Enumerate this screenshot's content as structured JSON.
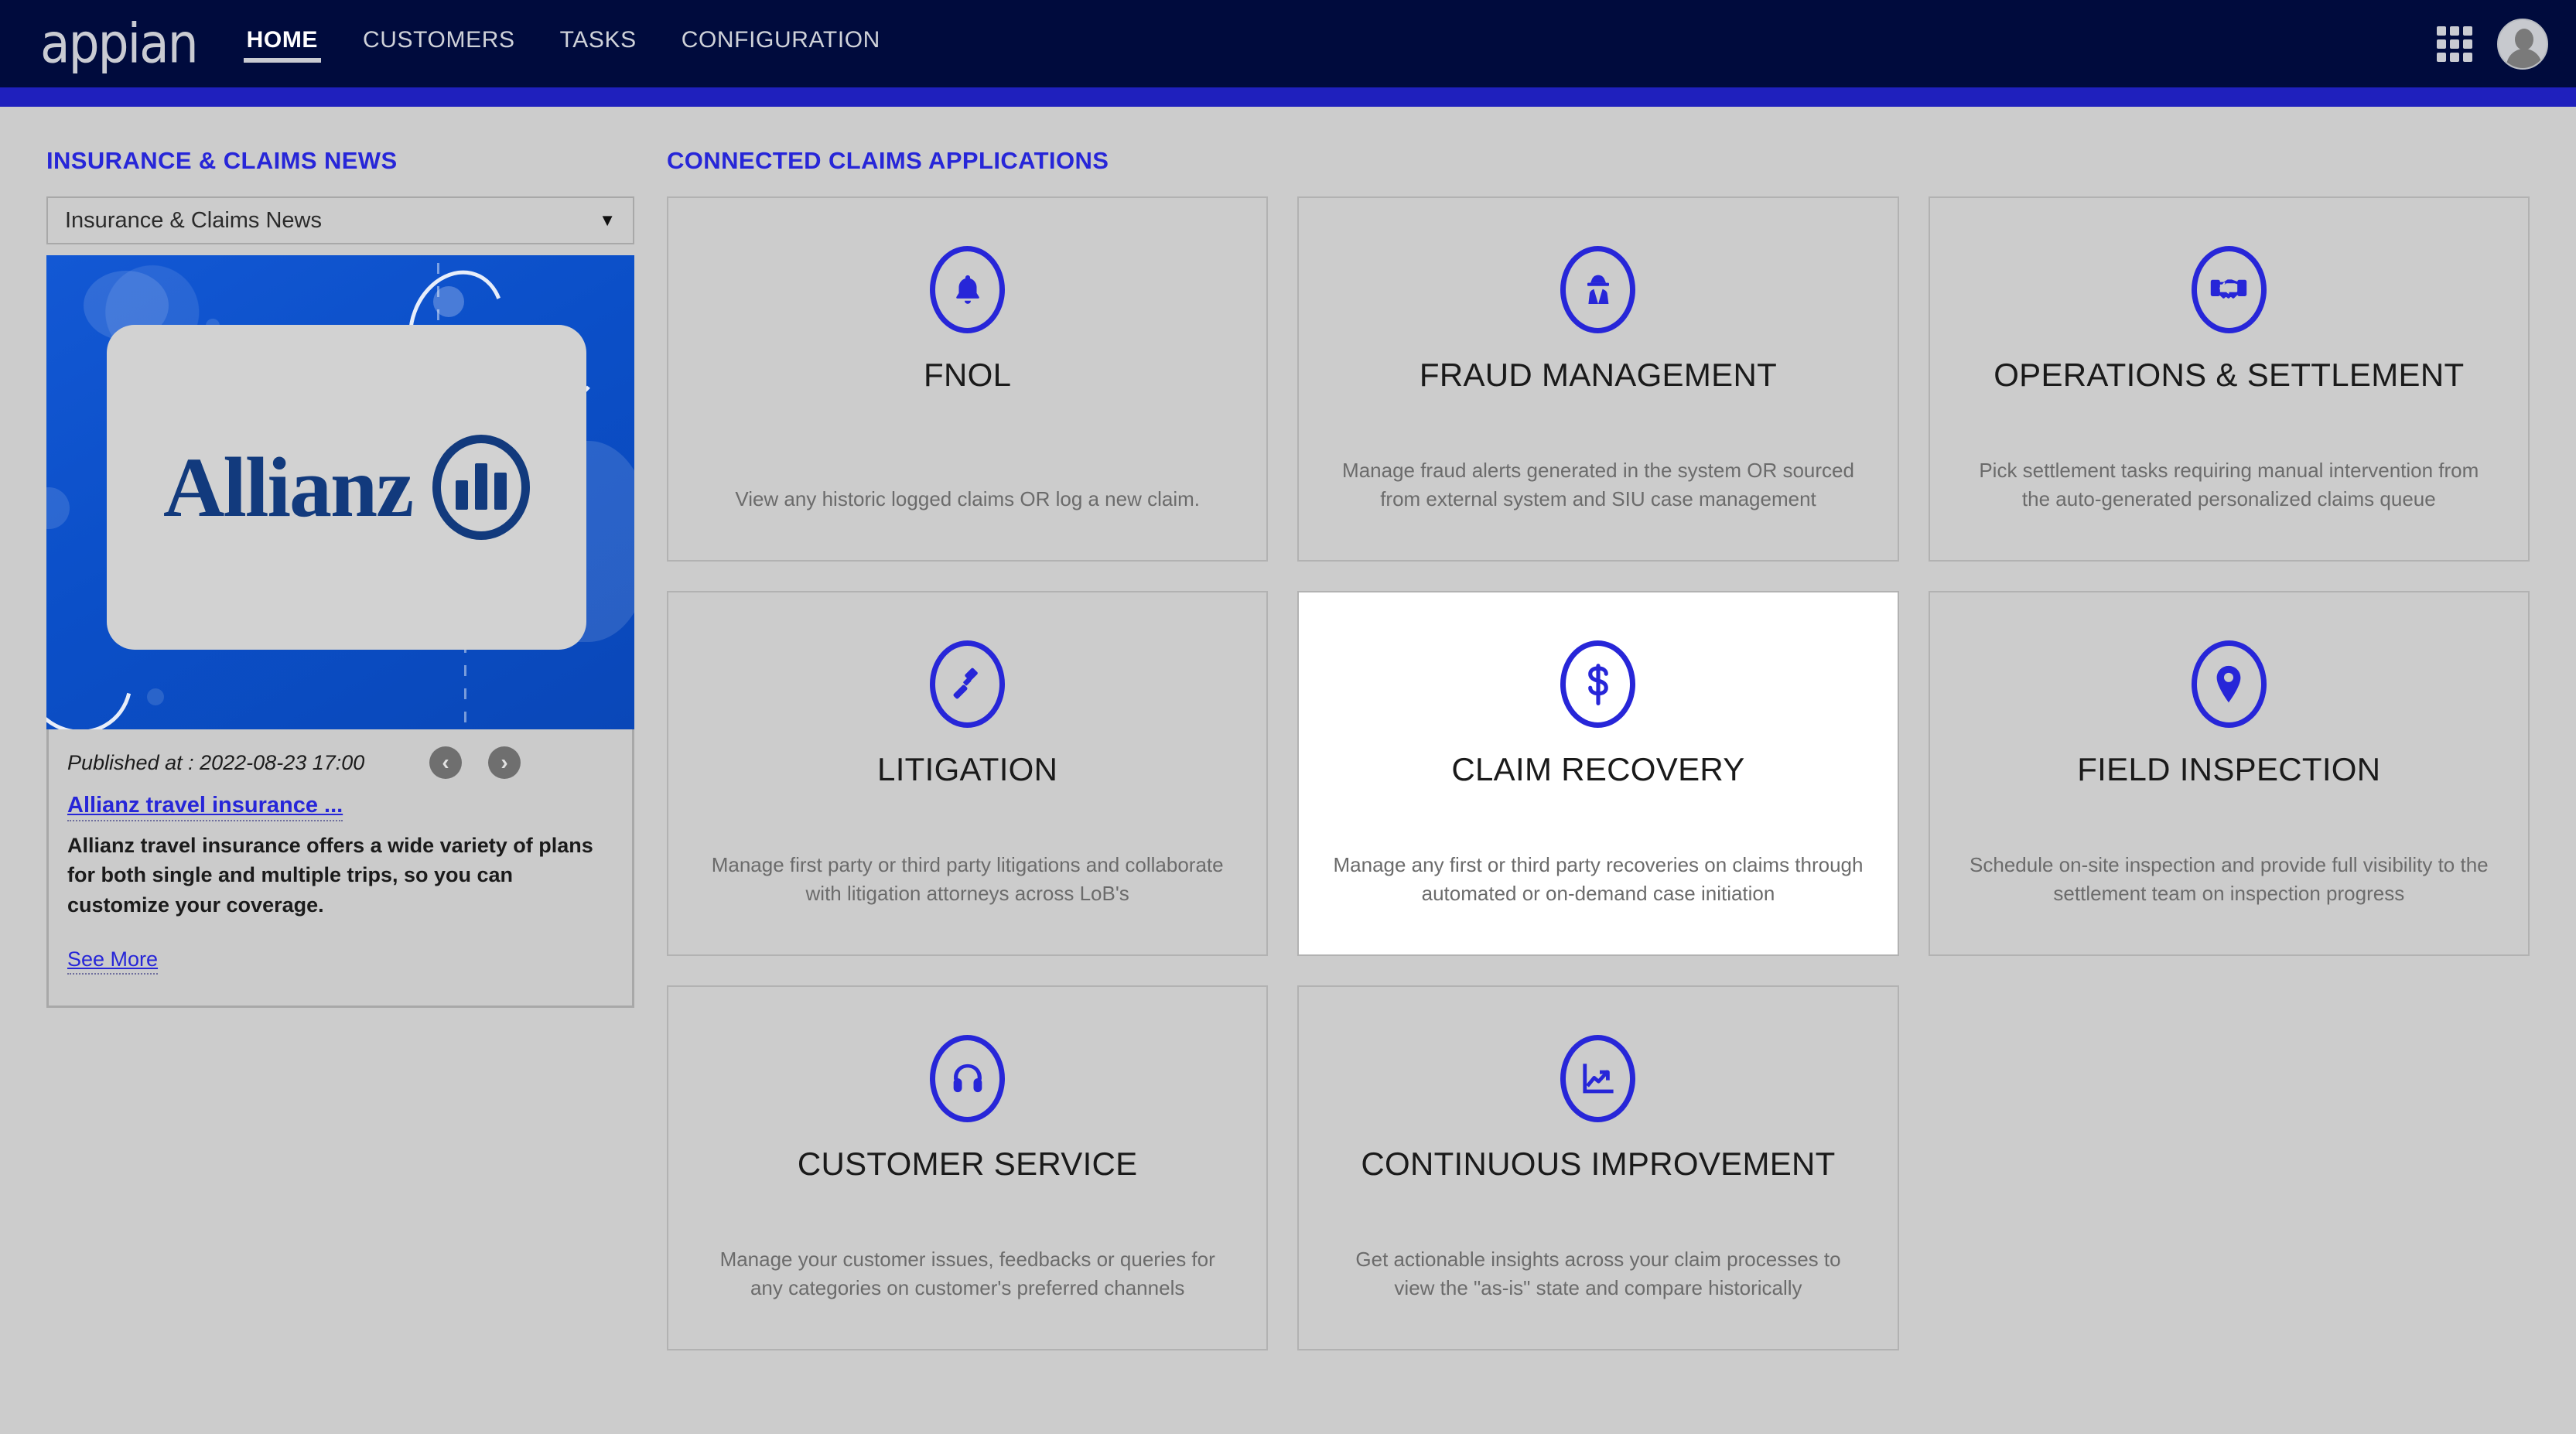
{
  "header": {
    "logo_text": "appian",
    "nav": [
      {
        "label": "HOME",
        "active": true
      },
      {
        "label": "CUSTOMERS",
        "active": false
      },
      {
        "label": "TASKS",
        "active": false
      },
      {
        "label": "CONFIGURATION",
        "active": false
      }
    ],
    "grid_icon": "apps-grid-icon",
    "avatar": "user-avatar",
    "navy": "#000b3d",
    "accent": "#1f20bd"
  },
  "news": {
    "section_title": "INSURANCE & CLAIMS NEWS",
    "select_value": "Insurance & Claims News",
    "select_caret": "▼",
    "image_alt": "Allianz",
    "brand_word": "Allianz",
    "published": "Published at : 2022-08-23 17:00",
    "prev_label": "‹",
    "next_label": "›",
    "headline": "Allianz travel insurance ...",
    "summary": "Allianz travel insurance offers a wide variety of plans for both single and multiple trips, so you can customize your coverage.",
    "see_more": "See More"
  },
  "apps": {
    "section_title": "CONNECTED CLAIMS APPLICATIONS",
    "accent_color": "#2726d8",
    "cards": [
      {
        "icon": "bell-icon",
        "title": "FNOL",
        "desc": "View any historic logged claims OR log a new claim.",
        "selected": false
      },
      {
        "icon": "spy-icon",
        "title": "FRAUD MANAGEMENT",
        "desc": "Manage fraud alerts generated in the system OR sourced from external system and SIU case management",
        "selected": false
      },
      {
        "icon": "handshake-icon",
        "title": "OPERATIONS & SETTLEMENT",
        "desc": "Pick settlement tasks requiring manual intervention from the auto-generated personalized claims queue",
        "selected": false
      },
      {
        "icon": "gavel-icon",
        "title": "LITIGATION",
        "desc": "Manage first party or third party litigations and collaborate with litigation attorneys across LoB's",
        "selected": false
      },
      {
        "icon": "dollar-icon",
        "title": "CLAIM RECOVERY",
        "desc": "Manage any first or third party recoveries on claims through automated or on-demand case initiation",
        "selected": true
      },
      {
        "icon": "map-pin-icon",
        "title": "FIELD INSPECTION",
        "desc": "Schedule on-site inspection and provide full visibility to the settlement team on inspection progress",
        "selected": false
      },
      {
        "icon": "headset-icon",
        "title": "CUSTOMER SERVICE",
        "desc": "Manage your customer issues, feedbacks or queries for any categories on customer's preferred channels",
        "selected": false
      },
      {
        "icon": "chart-up-icon",
        "title": "CONTINUOUS IMPROVEMENT",
        "desc": "Get actionable insights across your claim processes to view the \"as-is\" state and compare historically",
        "selected": false
      }
    ]
  }
}
